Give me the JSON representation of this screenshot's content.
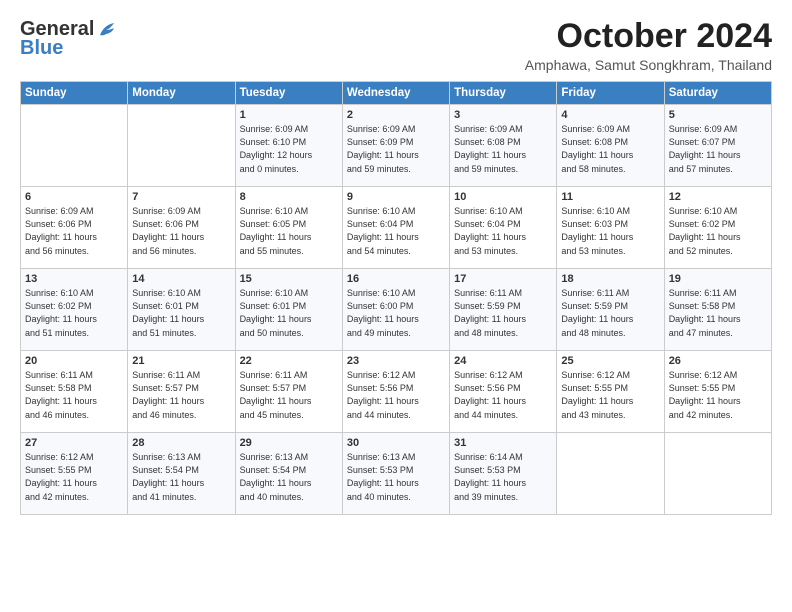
{
  "logo": {
    "line1": "General",
    "line2": "Blue"
  },
  "title": "October 2024",
  "subtitle": "Amphawa, Samut Songkhram, Thailand",
  "headers": [
    "Sunday",
    "Monday",
    "Tuesday",
    "Wednesday",
    "Thursday",
    "Friday",
    "Saturday"
  ],
  "weeks": [
    [
      {
        "day": "",
        "text": ""
      },
      {
        "day": "",
        "text": ""
      },
      {
        "day": "1",
        "text": "Sunrise: 6:09 AM\nSunset: 6:10 PM\nDaylight: 12 hours\nand 0 minutes."
      },
      {
        "day": "2",
        "text": "Sunrise: 6:09 AM\nSunset: 6:09 PM\nDaylight: 11 hours\nand 59 minutes."
      },
      {
        "day": "3",
        "text": "Sunrise: 6:09 AM\nSunset: 6:08 PM\nDaylight: 11 hours\nand 59 minutes."
      },
      {
        "day": "4",
        "text": "Sunrise: 6:09 AM\nSunset: 6:08 PM\nDaylight: 11 hours\nand 58 minutes."
      },
      {
        "day": "5",
        "text": "Sunrise: 6:09 AM\nSunset: 6:07 PM\nDaylight: 11 hours\nand 57 minutes."
      }
    ],
    [
      {
        "day": "6",
        "text": "Sunrise: 6:09 AM\nSunset: 6:06 PM\nDaylight: 11 hours\nand 56 minutes."
      },
      {
        "day": "7",
        "text": "Sunrise: 6:09 AM\nSunset: 6:06 PM\nDaylight: 11 hours\nand 56 minutes."
      },
      {
        "day": "8",
        "text": "Sunrise: 6:10 AM\nSunset: 6:05 PM\nDaylight: 11 hours\nand 55 minutes."
      },
      {
        "day": "9",
        "text": "Sunrise: 6:10 AM\nSunset: 6:04 PM\nDaylight: 11 hours\nand 54 minutes."
      },
      {
        "day": "10",
        "text": "Sunrise: 6:10 AM\nSunset: 6:04 PM\nDaylight: 11 hours\nand 53 minutes."
      },
      {
        "day": "11",
        "text": "Sunrise: 6:10 AM\nSunset: 6:03 PM\nDaylight: 11 hours\nand 53 minutes."
      },
      {
        "day": "12",
        "text": "Sunrise: 6:10 AM\nSunset: 6:02 PM\nDaylight: 11 hours\nand 52 minutes."
      }
    ],
    [
      {
        "day": "13",
        "text": "Sunrise: 6:10 AM\nSunset: 6:02 PM\nDaylight: 11 hours\nand 51 minutes."
      },
      {
        "day": "14",
        "text": "Sunrise: 6:10 AM\nSunset: 6:01 PM\nDaylight: 11 hours\nand 51 minutes."
      },
      {
        "day": "15",
        "text": "Sunrise: 6:10 AM\nSunset: 6:01 PM\nDaylight: 11 hours\nand 50 minutes."
      },
      {
        "day": "16",
        "text": "Sunrise: 6:10 AM\nSunset: 6:00 PM\nDaylight: 11 hours\nand 49 minutes."
      },
      {
        "day": "17",
        "text": "Sunrise: 6:11 AM\nSunset: 5:59 PM\nDaylight: 11 hours\nand 48 minutes."
      },
      {
        "day": "18",
        "text": "Sunrise: 6:11 AM\nSunset: 5:59 PM\nDaylight: 11 hours\nand 48 minutes."
      },
      {
        "day": "19",
        "text": "Sunrise: 6:11 AM\nSunset: 5:58 PM\nDaylight: 11 hours\nand 47 minutes."
      }
    ],
    [
      {
        "day": "20",
        "text": "Sunrise: 6:11 AM\nSunset: 5:58 PM\nDaylight: 11 hours\nand 46 minutes."
      },
      {
        "day": "21",
        "text": "Sunrise: 6:11 AM\nSunset: 5:57 PM\nDaylight: 11 hours\nand 46 minutes."
      },
      {
        "day": "22",
        "text": "Sunrise: 6:11 AM\nSunset: 5:57 PM\nDaylight: 11 hours\nand 45 minutes."
      },
      {
        "day": "23",
        "text": "Sunrise: 6:12 AM\nSunset: 5:56 PM\nDaylight: 11 hours\nand 44 minutes."
      },
      {
        "day": "24",
        "text": "Sunrise: 6:12 AM\nSunset: 5:56 PM\nDaylight: 11 hours\nand 44 minutes."
      },
      {
        "day": "25",
        "text": "Sunrise: 6:12 AM\nSunset: 5:55 PM\nDaylight: 11 hours\nand 43 minutes."
      },
      {
        "day": "26",
        "text": "Sunrise: 6:12 AM\nSunset: 5:55 PM\nDaylight: 11 hours\nand 42 minutes."
      }
    ],
    [
      {
        "day": "27",
        "text": "Sunrise: 6:12 AM\nSunset: 5:55 PM\nDaylight: 11 hours\nand 42 minutes."
      },
      {
        "day": "28",
        "text": "Sunrise: 6:13 AM\nSunset: 5:54 PM\nDaylight: 11 hours\nand 41 minutes."
      },
      {
        "day": "29",
        "text": "Sunrise: 6:13 AM\nSunset: 5:54 PM\nDaylight: 11 hours\nand 40 minutes."
      },
      {
        "day": "30",
        "text": "Sunrise: 6:13 AM\nSunset: 5:53 PM\nDaylight: 11 hours\nand 40 minutes."
      },
      {
        "day": "31",
        "text": "Sunrise: 6:14 AM\nSunset: 5:53 PM\nDaylight: 11 hours\nand 39 minutes."
      },
      {
        "day": "",
        "text": ""
      },
      {
        "day": "",
        "text": ""
      }
    ]
  ]
}
